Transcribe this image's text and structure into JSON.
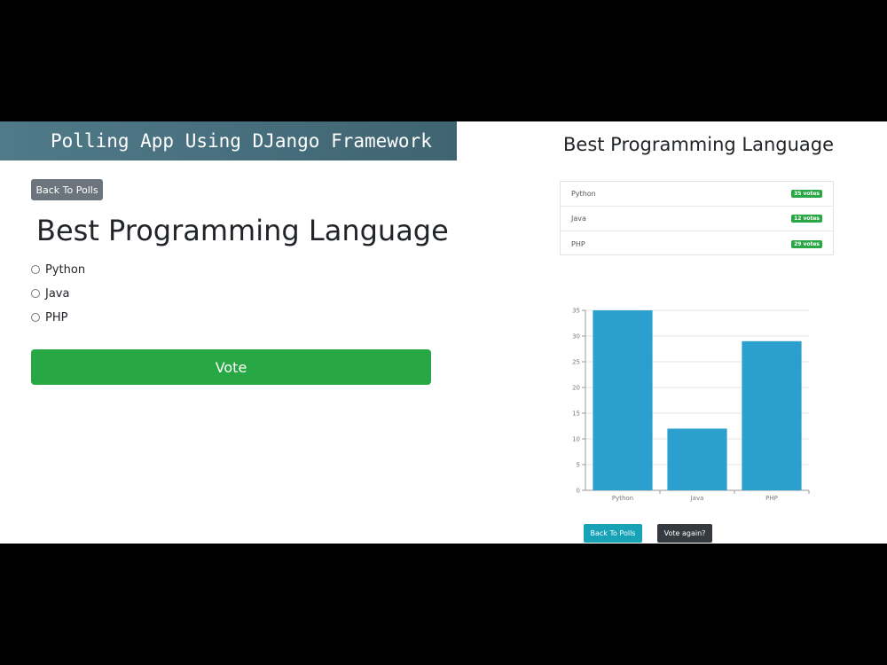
{
  "vote_page": {
    "banner_title": "Polling App Using DJango Framework",
    "back_button": "Back To Polls",
    "question": "Best Programming Language",
    "choices": [
      "Python",
      "Java",
      "PHP"
    ],
    "vote_button": "Vote"
  },
  "results_page": {
    "title": "Best Programming Language",
    "results": [
      {
        "choice": "Python",
        "votes": "35",
        "suffix": "votes"
      },
      {
        "choice": "Java",
        "votes": "12",
        "suffix": "votes"
      },
      {
        "choice": "PHP",
        "votes": "29",
        "suffix": "votes"
      }
    ],
    "back_button": "Back To Polls",
    "vote_again_button": "Vote again?"
  },
  "colors": {
    "bar": "#2b9fce",
    "badge": "#28a745",
    "vote_button": "#28a745"
  },
  "chart_data": {
    "type": "bar",
    "categories": [
      "Python",
      "Java",
      "PHP"
    ],
    "values": [
      35,
      12,
      29
    ],
    "title": "",
    "xlabel": "",
    "ylabel": "",
    "ylim": [
      0,
      35
    ],
    "yticks": [
      0,
      5,
      10,
      15,
      20,
      25,
      30,
      35
    ],
    "grid": true,
    "legend": "none"
  }
}
